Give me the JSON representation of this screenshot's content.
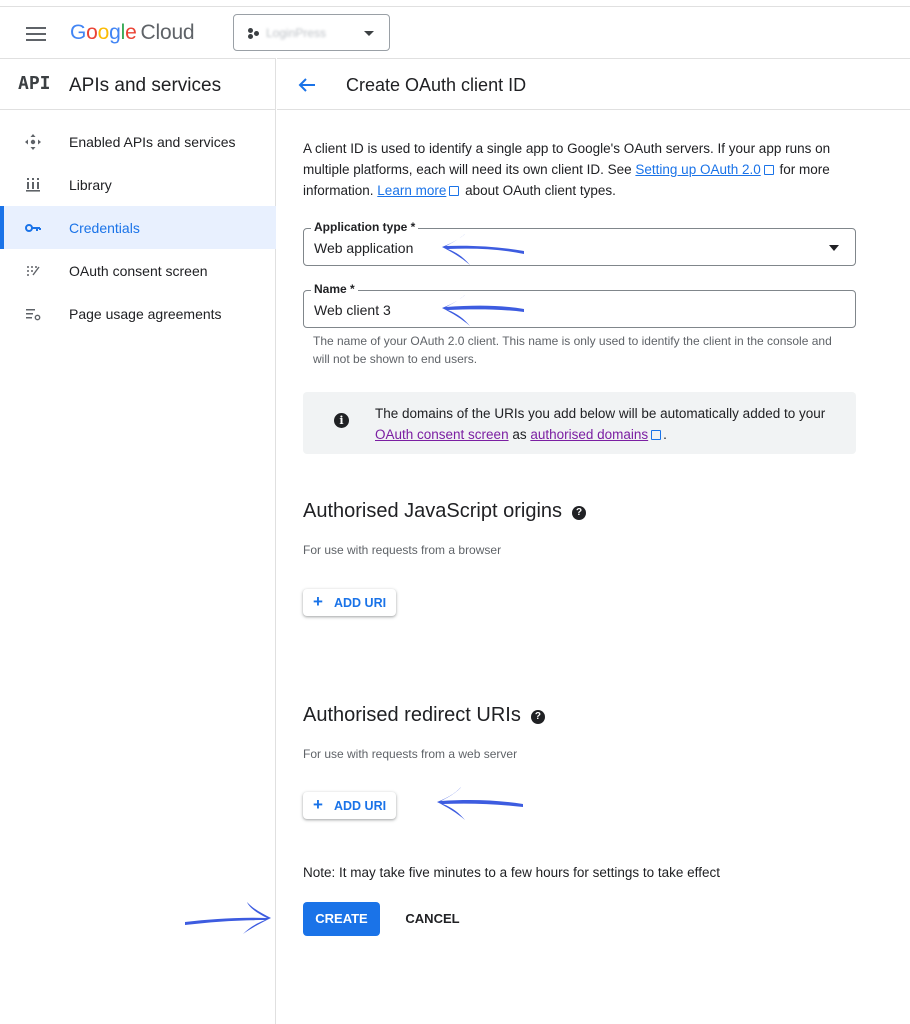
{
  "app": {
    "logo_letters": [
      "G",
      "o",
      "o",
      "g",
      "l",
      "e"
    ],
    "logo_product": "Cloud",
    "project_name": "LoginPress"
  },
  "sidebar": {
    "badge": "API",
    "title": "APIs and services",
    "items": [
      {
        "label": "Enabled APIs and services",
        "icon": "enabled-apis-icon",
        "active": false
      },
      {
        "label": "Library",
        "icon": "library-icon",
        "active": false
      },
      {
        "label": "Credentials",
        "icon": "key-icon",
        "active": true
      },
      {
        "label": "OAuth consent screen",
        "icon": "consent-screen-icon",
        "active": false
      },
      {
        "label": "Page usage agreements",
        "icon": "settings-list-icon",
        "active": false
      }
    ]
  },
  "header": {
    "title": "Create OAuth client ID"
  },
  "intro": {
    "text_1": "A client ID is used to identify a single app to Google's OAuth servers. If your app runs on multiple platforms, each will need its own client ID. See ",
    "link_1": "Setting up OAuth 2.0",
    "text_2": " for more information. ",
    "link_2": "Learn more",
    "text_3": " about OAuth client types."
  },
  "form": {
    "app_type_label": "Application type *",
    "app_type_value": "Web application",
    "name_label": "Name *",
    "name_value": "Web client 3",
    "name_hint": "The name of your OAuth 2.0 client. This name is only used to identify the client in the console and will not be shown to end users."
  },
  "info": {
    "text_1": "The domains of the URIs you add below will be automatically added to your ",
    "link_1": "OAuth consent screen",
    "text_2": " as ",
    "link_2": "authorised domains",
    "text_3": "."
  },
  "js_origins": {
    "title": "Authorised JavaScript origins",
    "subtitle": "For use with requests from a browser",
    "button": "ADD URI"
  },
  "redirect_uris": {
    "title": "Authorised redirect URIs",
    "subtitle": "For use with requests from a web server",
    "button": "ADD URI"
  },
  "footer": {
    "note": "Note: It may take five minutes to a few hours for settings to take effect",
    "create": "CREATE",
    "cancel": "CANCEL"
  },
  "colors": {
    "accent": "#1a73e8",
    "annotation_arrow": "#3d5ce0",
    "active_nav_bg": "#e8f0fe",
    "info_bg": "#f1f3f4"
  }
}
